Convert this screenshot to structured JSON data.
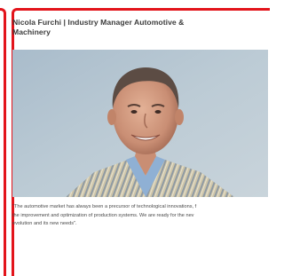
{
  "card": {
    "title_line1": "Nicola Furchi | Industry Manager Automotive &",
    "title_line2": "Machinery",
    "photo_subject": "portrait-photo",
    "quote_lines": [
      "\"The automotive market has always been a precursor of technological innovations, f",
      "the improvement and optimization of production systems. We are ready for the nev",
      "evolution and its new needs\"."
    ]
  },
  "colors": {
    "frame": "#e3141b",
    "title": "#3c3c3c",
    "text": "#4a4a4a"
  }
}
